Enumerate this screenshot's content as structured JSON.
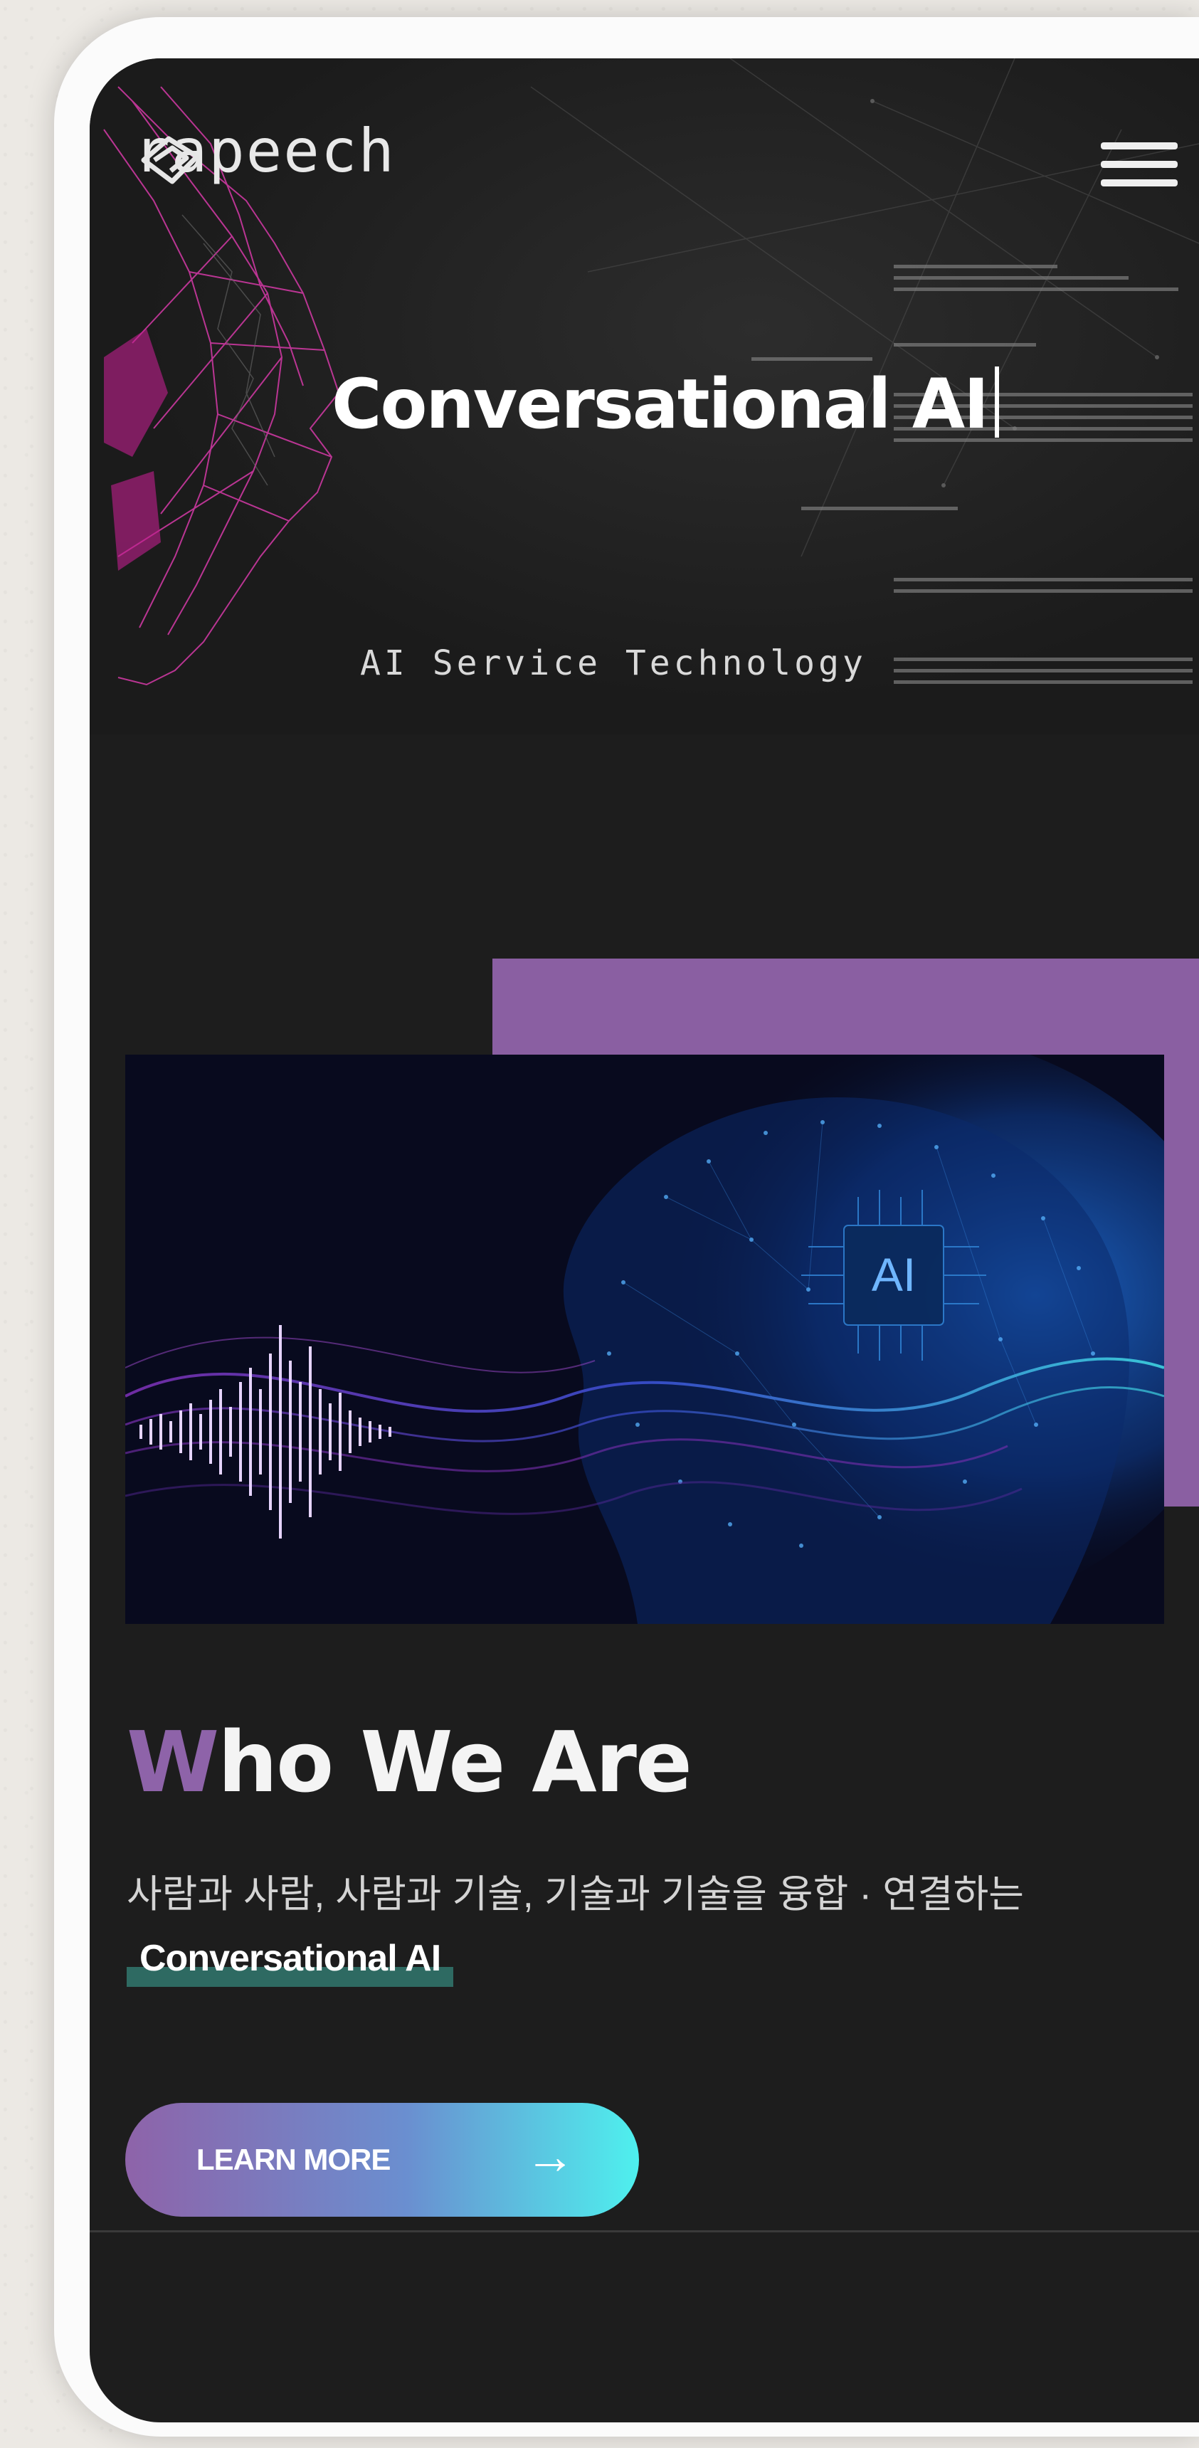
{
  "header": {
    "logo_text": "rapeech",
    "logo_icon": "rapeech-logo-icon",
    "menu_icon": "hamburger-menu-icon"
  },
  "hero": {
    "title": "Conversational AI",
    "subtitle": "AI Service Technology"
  },
  "feature_image": {
    "chip_label": "AI"
  },
  "about": {
    "heading_accent": "W",
    "heading_rest": "ho We Are",
    "description": "사람과 사람, 사람과 기술, 기술과 기술을 융합 · 연결하는",
    "highlight": "Conversational AI",
    "button_label": "LEARN MORE",
    "button_icon": "arrow-right-icon"
  },
  "colors": {
    "accent_purple": "#8a5fa2",
    "accent_teal": "#2e6a62",
    "button_gradient_end": "#4ef0ee",
    "background": "#1d1d1d"
  }
}
